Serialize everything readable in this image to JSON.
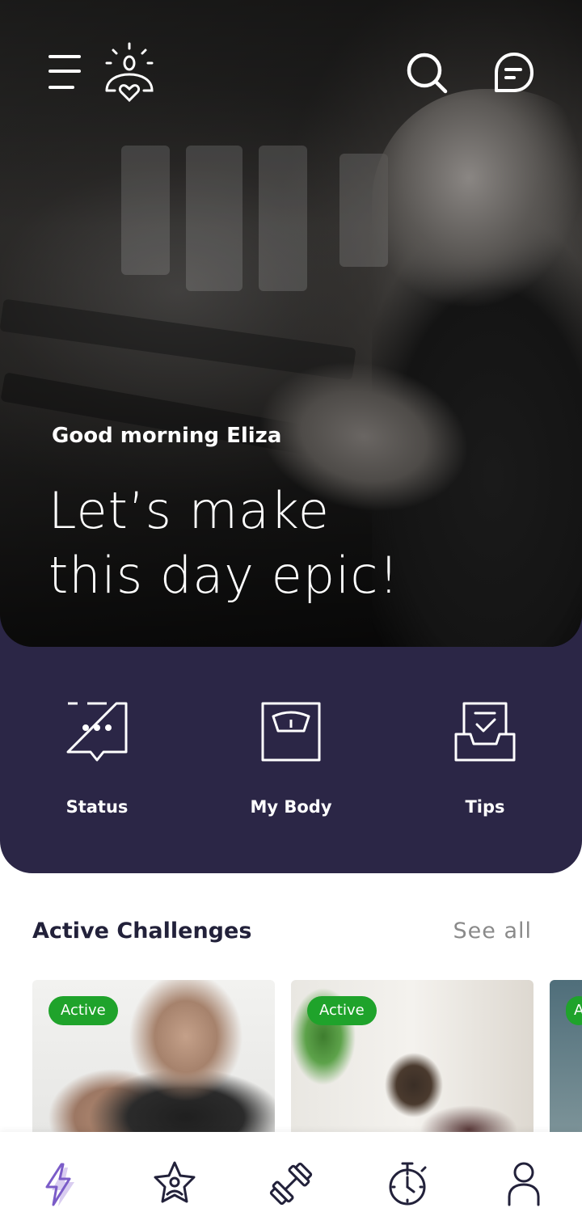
{
  "header": {
    "icons": [
      "menu-icon",
      "logo-sun-heart-icon",
      "search-icon",
      "chat-icon"
    ]
  },
  "hero": {
    "greeting": "Good morning Eliza",
    "headline_line1": "Let’s make",
    "headline_line2": "this day epic!"
  },
  "quick_actions": [
    {
      "label": "Status",
      "icon": "status-chat-icon"
    },
    {
      "label": "My Body",
      "icon": "scale-icon"
    },
    {
      "label": "Tips",
      "icon": "tips-tray-icon"
    }
  ],
  "challenges": {
    "title": "Active Challenges",
    "see_all": "See all",
    "cards": [
      {
        "badge": "Active"
      },
      {
        "badge": "Active"
      },
      {
        "badge": "A"
      }
    ]
  },
  "bottom_nav": {
    "items": [
      "lightning-icon",
      "star-person-icon",
      "dumbbell-icon",
      "stopwatch-icon",
      "profile-icon"
    ],
    "active_index": 0
  },
  "colors": {
    "panel": "#2b2646",
    "badge": "#1fa32b",
    "accent": "#7b5cc8",
    "title": "#22213a"
  }
}
